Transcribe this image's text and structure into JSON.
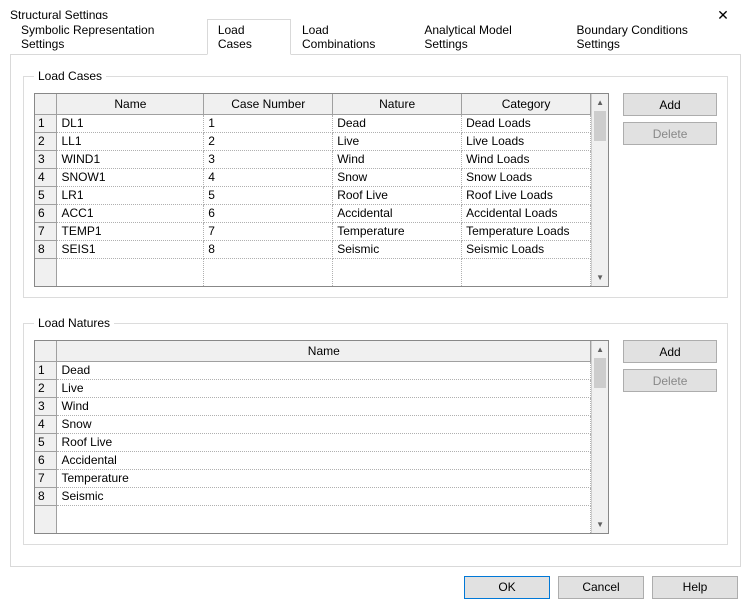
{
  "window": {
    "title": "Structural Settings"
  },
  "tabs": [
    {
      "label": "Symbolic Representation Settings"
    },
    {
      "label": "Load Cases"
    },
    {
      "label": "Load Combinations"
    },
    {
      "label": "Analytical Model Settings"
    },
    {
      "label": "Boundary Conditions Settings"
    }
  ],
  "loadCases": {
    "legend": "Load Cases",
    "headers": {
      "name": "Name",
      "caseNumber": "Case Number",
      "nature": "Nature",
      "category": "Category"
    },
    "rows": [
      {
        "n": "1",
        "name": "DL1",
        "case": "1",
        "nature": "Dead",
        "category": "Dead Loads"
      },
      {
        "n": "2",
        "name": "LL1",
        "case": "2",
        "nature": "Live",
        "category": "Live Loads"
      },
      {
        "n": "3",
        "name": "WIND1",
        "case": "3",
        "nature": "Wind",
        "category": "Wind Loads"
      },
      {
        "n": "4",
        "name": "SNOW1",
        "case": "4",
        "nature": "Snow",
        "category": "Snow Loads"
      },
      {
        "n": "5",
        "name": "LR1",
        "case": "5",
        "nature": "Roof Live",
        "category": "Roof Live Loads"
      },
      {
        "n": "6",
        "name": "ACC1",
        "case": "6",
        "nature": "Accidental",
        "category": "Accidental Loads"
      },
      {
        "n": "7",
        "name": "TEMP1",
        "case": "7",
        "nature": "Temperature",
        "category": "Temperature Loads"
      },
      {
        "n": "8",
        "name": "SEIS1",
        "case": "8",
        "nature": "Seismic",
        "category": "Seismic Loads"
      }
    ],
    "buttons": {
      "add": "Add",
      "delete": "Delete"
    }
  },
  "loadNatures": {
    "legend": "Load Natures",
    "headers": {
      "name": "Name"
    },
    "rows": [
      {
        "n": "1",
        "name": "Dead"
      },
      {
        "n": "2",
        "name": "Live"
      },
      {
        "n": "3",
        "name": "Wind"
      },
      {
        "n": "4",
        "name": "Snow"
      },
      {
        "n": "5",
        "name": "Roof Live"
      },
      {
        "n": "6",
        "name": "Accidental"
      },
      {
        "n": "7",
        "name": "Temperature"
      },
      {
        "n": "8",
        "name": "Seismic"
      }
    ],
    "buttons": {
      "add": "Add",
      "delete": "Delete"
    }
  },
  "footer": {
    "ok": "OK",
    "cancel": "Cancel",
    "help": "Help"
  }
}
